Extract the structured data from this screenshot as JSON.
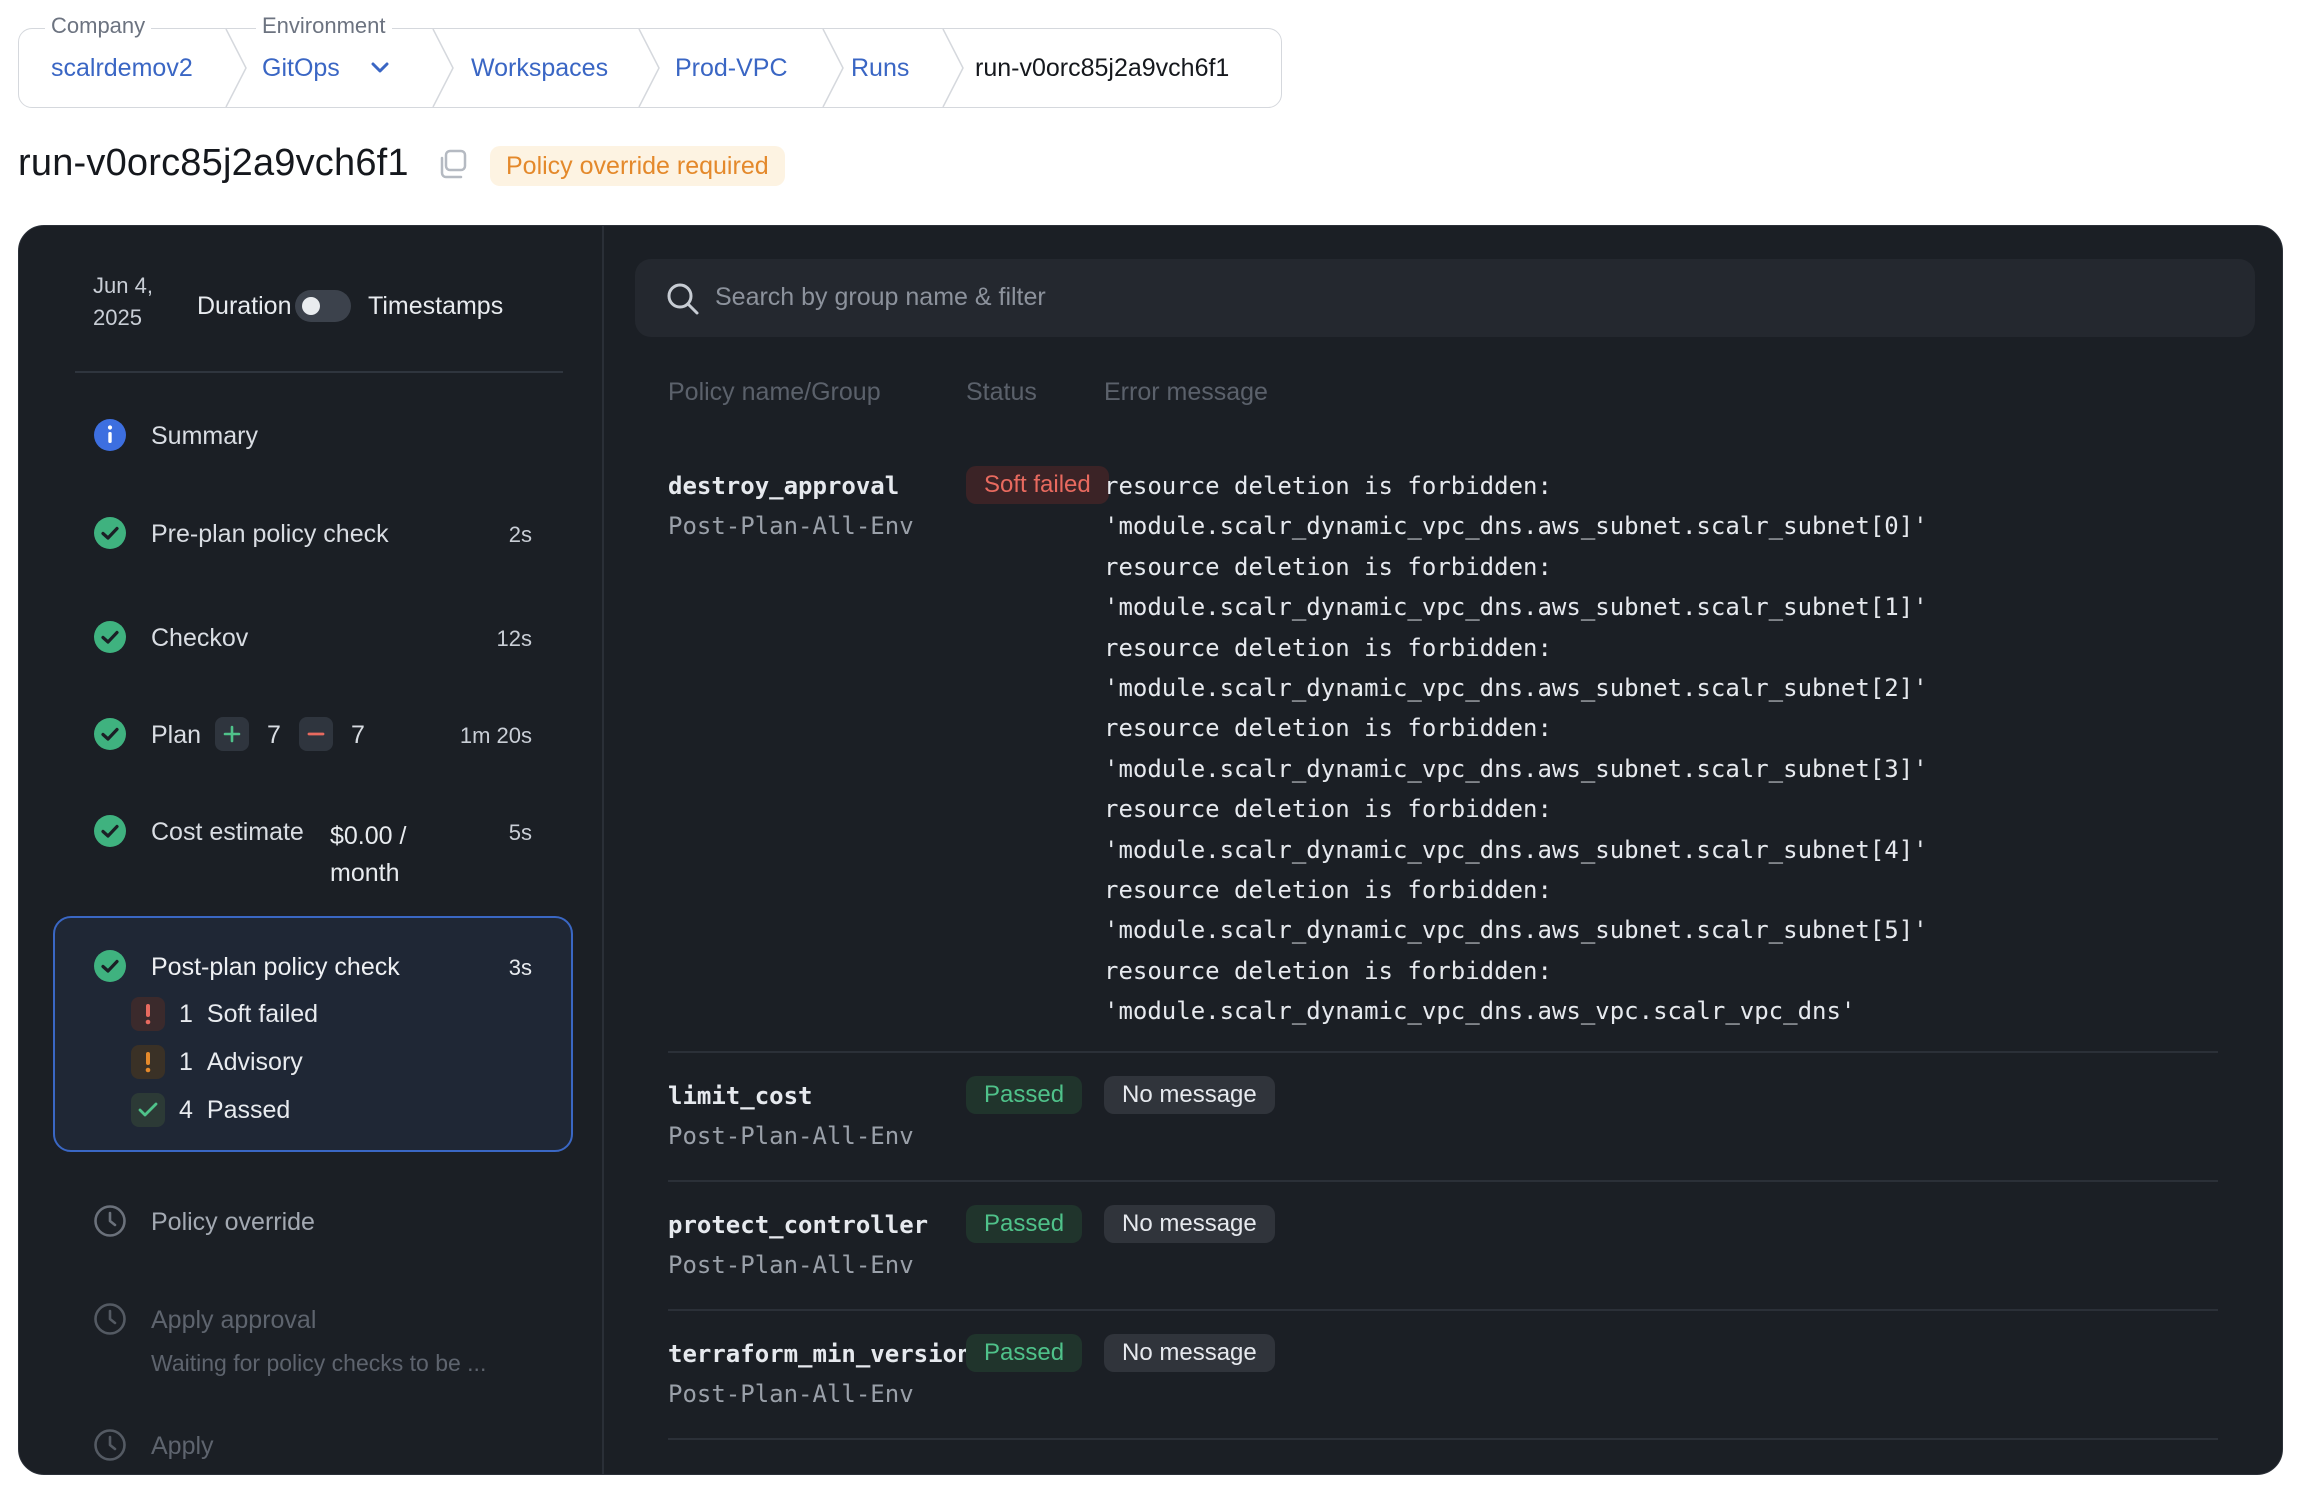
{
  "breadcrumb": {
    "company_label": "Company",
    "company": "scalrdemov2",
    "environment_label": "Environment",
    "environment": "GitOps",
    "workspaces": "Workspaces",
    "workspace": "Prod-VPC",
    "runs": "Runs",
    "run": "run-v0orc85j2a9vch6f1"
  },
  "header": {
    "title": "run-v0orc85j2a9vch6f1",
    "badge": "Policy override required"
  },
  "sidebar": {
    "date_line1": "Jun 4,",
    "date_line2": "2025",
    "duration_label": "Duration",
    "timestamps_label": "Timestamps",
    "summary": "Summary",
    "pre_plan": {
      "label": "Pre-plan policy check",
      "time": "2s"
    },
    "checkov": {
      "label": "Checkov",
      "time": "12s"
    },
    "plan": {
      "label": "Plan",
      "add": "7",
      "destroy": "7",
      "time": "1m 20s"
    },
    "cost": {
      "label": "Cost estimate",
      "value_line1": "$0.00 /",
      "value_line2": "month",
      "time": "5s"
    },
    "post_plan": {
      "label": "Post-plan policy check",
      "time": "3s",
      "soft_failed_count": "1",
      "soft_failed_label": "Soft failed",
      "advisory_count": "1",
      "advisory_label": "Advisory",
      "passed_count": "4",
      "passed_label": "Passed"
    },
    "policy_override": "Policy override",
    "apply_approval": {
      "label": "Apply approval",
      "sub": "Waiting for policy checks to be ..."
    },
    "apply": "Apply"
  },
  "content": {
    "search_placeholder": "Search by group name & filter",
    "columns": {
      "name": "Policy name/Group",
      "status": "Status",
      "error": "Error message"
    },
    "rows": [
      {
        "name": "destroy_approval",
        "group": "Post-Plan-All-Env",
        "status": "Soft failed",
        "errors": [
          "resource deletion is forbidden:",
          "'module.scalr_dynamic_vpc_dns.aws_subnet.scalr_subnet[0]'",
          "resource deletion is forbidden:",
          "'module.scalr_dynamic_vpc_dns.aws_subnet.scalr_subnet[1]'",
          "resource deletion is forbidden:",
          "'module.scalr_dynamic_vpc_dns.aws_subnet.scalr_subnet[2]'",
          "resource deletion is forbidden:",
          "'module.scalr_dynamic_vpc_dns.aws_subnet.scalr_subnet[3]'",
          "resource deletion is forbidden:",
          "'module.scalr_dynamic_vpc_dns.aws_subnet.scalr_subnet[4]'",
          "resource deletion is forbidden:",
          "'module.scalr_dynamic_vpc_dns.aws_subnet.scalr_subnet[5]'",
          "resource deletion is forbidden:",
          "'module.scalr_dynamic_vpc_dns.aws_vpc.scalr_vpc_dns'"
        ]
      },
      {
        "name": "limit_cost",
        "group": "Post-Plan-All-Env",
        "status": "Passed",
        "message": "No message"
      },
      {
        "name": "protect_controller",
        "group": "Post-Plan-All-Env",
        "status": "Passed",
        "message": "No message"
      },
      {
        "name": "terraform_min_version",
        "group": "Post-Plan-All-Env",
        "status": "Passed",
        "message": "No message"
      }
    ]
  }
}
